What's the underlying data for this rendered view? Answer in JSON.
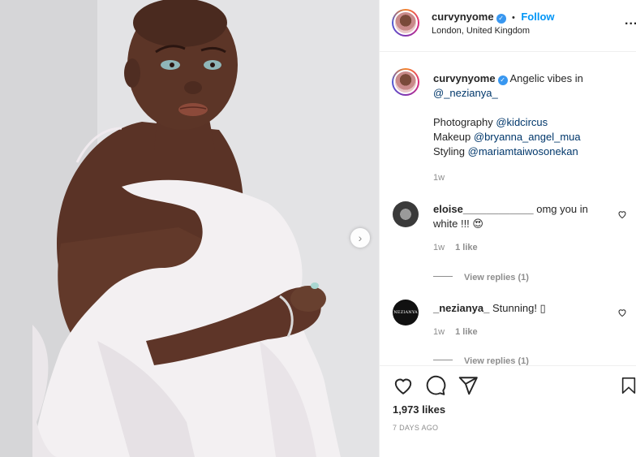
{
  "post": {
    "username": "curvynyome",
    "follow_label": "Follow",
    "dot": "•",
    "location": "London, United Kingdom",
    "more_label": "...",
    "next_label": "›",
    "verified_mark": "✓"
  },
  "caption": {
    "username": "curvynyome",
    "text_lead": "Angelic vibes in",
    "mention_main": "@_nezianya_",
    "line_photography": "Photography",
    "mention_photography": "@kidcircus",
    "line_makeup": "Makeup",
    "mention_makeup": "@bryanna_angel_mua",
    "line_styling": "Styling",
    "mention_styling": "@mariamtaiwosonekan",
    "age": "1w"
  },
  "comments": [
    {
      "username": "eloise____________",
      "text_a": "omg you in",
      "text_b": "white !!! 😍",
      "age": "1w",
      "likes": "1 like",
      "replies": "View replies (1)"
    },
    {
      "username": "_nezianya_",
      "text_a": "Stunning! ▯",
      "age": "1w",
      "likes": "1 like",
      "replies": "View replies (1)",
      "avatar_text": "NEZIANYA"
    }
  ],
  "footer": {
    "likes": "1,973 likes",
    "date": "7 DAYS AGO"
  },
  "colors": {
    "accent": "#0095f6",
    "verified": "#3897f0",
    "text": "#262626",
    "muted": "#8e8e8e",
    "mention": "#00376b"
  },
  "icons": [
    "heart-icon",
    "comment-icon",
    "share-icon",
    "bookmark-icon",
    "chevron-right-icon",
    "verified-badge-icon",
    "more-icon"
  ]
}
